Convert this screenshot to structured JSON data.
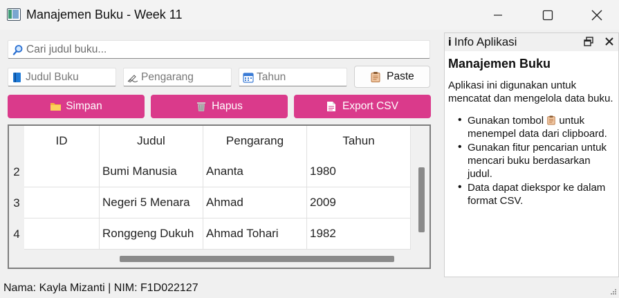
{
  "window": {
    "title": "Manajemen Buku - Week 11"
  },
  "search": {
    "placeholder": "Cari judul buku..."
  },
  "form": {
    "judul_placeholder": "Judul Buku",
    "pengarang_placeholder": "Pengarang",
    "tahun_placeholder": "Tahun",
    "paste_label": "Paste"
  },
  "actions": {
    "simpan_label": "Simpan",
    "hapus_label": "Hapus",
    "export_label": "Export CSV"
  },
  "table": {
    "headers": {
      "id": "ID",
      "judul": "Judul",
      "pengarang": "Pengarang",
      "tahun": "Tahun"
    },
    "rows": [
      {
        "num": "2",
        "id": "",
        "judul": "Bumi Manusia",
        "pengarang": "Ananta",
        "tahun": "1980"
      },
      {
        "num": "3",
        "id": "",
        "judul": "Negeri 5 Menara",
        "pengarang": "Ahmad",
        "tahun": "2009"
      },
      {
        "num": "4",
        "id": "",
        "judul": "Ronggeng Dukuh",
        "pengarang": "Ahmad Tohari",
        "tahun": "1982"
      }
    ]
  },
  "info_panel": {
    "icon_label": "i",
    "title": "Info Aplikasi",
    "heading": "Manajemen Buku",
    "description": "Aplikasi ini digunakan untuk mencatat dan mengelola data buku.",
    "bullets": {
      "b1_before": "Gunakan tombol",
      "b1_after": "untuk menempel data dari clipboard.",
      "b2": "Gunakan fitur pencarian untuk mencari buku berdasarkan judul.",
      "b3": "Data dapat diekspor ke dalam format CSV."
    }
  },
  "status_bar": {
    "text": "Nama: Kayla Mizanti | NIM: F1D022127"
  },
  "colors": {
    "accent": "#da3a8b",
    "scrollbar": "#8a8a8a"
  },
  "icons": [
    "app-icon",
    "minimize-icon",
    "maximize-icon",
    "close-icon",
    "search-icon",
    "book-icon",
    "pen-icon",
    "calendar-icon",
    "clipboard-icon",
    "folder-icon",
    "trash-icon",
    "document-icon",
    "float-icon"
  ]
}
